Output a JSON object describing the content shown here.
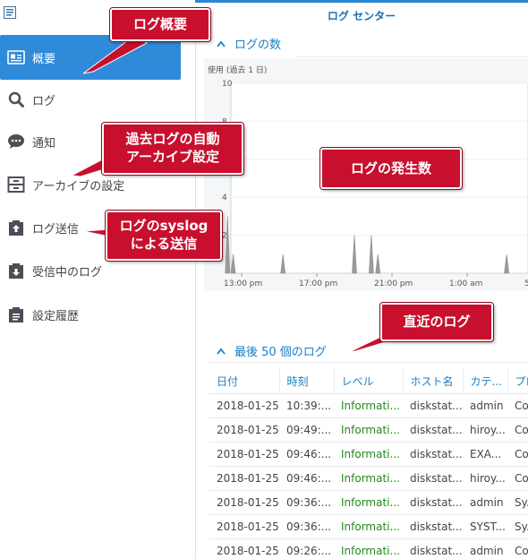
{
  "window": {
    "title": "ログ センター"
  },
  "sidebar": {
    "items": [
      {
        "label": "概要",
        "icon": "overview-card-icon",
        "active": true
      },
      {
        "label": "ログ",
        "icon": "search-icon",
        "active": false
      },
      {
        "label": "通知",
        "icon": "chat-bubble-icon",
        "active": false
      },
      {
        "label": "アーカイブの設定",
        "icon": "archive-box-icon",
        "active": false
      },
      {
        "label": "ログ送信",
        "icon": "upload-clipboard-icon",
        "active": false
      },
      {
        "label": "受信中のログ",
        "icon": "download-clipboard-icon",
        "active": false
      },
      {
        "label": "設定履歴",
        "icon": "clipboard-list-icon",
        "active": false
      }
    ]
  },
  "count_section": {
    "title": "ログの数"
  },
  "chart_data": {
    "type": "area",
    "title": "使用 (過去 1 日)",
    "xlabel": "",
    "ylabel": "",
    "ylim": [
      0,
      10
    ],
    "yticks": [
      "10",
      "8",
      "6",
      "4",
      "2"
    ],
    "xticks": [
      "13:00 pm",
      "17:00 pm",
      "21:00 pm",
      "1:00 am",
      "5:00 am"
    ],
    "x_hours": [
      12,
      28
    ],
    "peaks": [
      {
        "x": 12.25,
        "y": 3
      },
      {
        "x": 12.55,
        "y": 1
      },
      {
        "x": 15.2,
        "y": 1
      },
      {
        "x": 19.0,
        "y": 2
      },
      {
        "x": 19.9,
        "y": 2
      },
      {
        "x": 20.25,
        "y": 1
      },
      {
        "x": 27.1,
        "y": 1
      },
      {
        "x": 30.2,
        "y": 1
      },
      {
        "x": 35.8,
        "y": 1
      },
      {
        "x": 39.95,
        "y": 9
      },
      {
        "x": 40.35,
        "y": 8
      }
    ],
    "color": "#9b9b9b",
    "grid": true
  },
  "recent_section": {
    "title": "最後 50 個のログ"
  },
  "table": {
    "columns": [
      "日付",
      "時刻",
      "レベル",
      "ホスト名",
      "カテ...",
      "プロ..."
    ],
    "rows": [
      [
        "2018-01-25",
        "10:39:...",
        "Informati...",
        "diskstat...",
        "admin",
        "Co..."
      ],
      [
        "2018-01-25",
        "09:49:...",
        "Informati...",
        "diskstat...",
        "hiroy...",
        "Co..."
      ],
      [
        "2018-01-25",
        "09:46:...",
        "Informati...",
        "diskstat...",
        "EXA...",
        "Co..."
      ],
      [
        "2018-01-25",
        "09:46:...",
        "Informati...",
        "diskstat...",
        "hiroy...",
        "Co..."
      ],
      [
        "2018-01-25",
        "09:36:...",
        "Informati...",
        "diskstat...",
        "admin",
        "Sy..."
      ],
      [
        "2018-01-25",
        "09:36:...",
        "Informati...",
        "diskstat...",
        "SYST...",
        "Sy..."
      ],
      [
        "2018-01-25",
        "09:26:...",
        "Informati...",
        "diskstat...",
        "admin",
        "Co..."
      ]
    ]
  },
  "callouts": {
    "overview": "ログ概要",
    "archive": [
      "過去ログの自動",
      "アーカイブ設定"
    ],
    "chart": "ログの発生数",
    "syslog": [
      "ログのsyslog",
      "による送信"
    ],
    "recent": "直近のログ"
  },
  "colors": {
    "accent": "#2f8ad9",
    "callout": "#c8102e",
    "info_level": "#238a1c"
  }
}
